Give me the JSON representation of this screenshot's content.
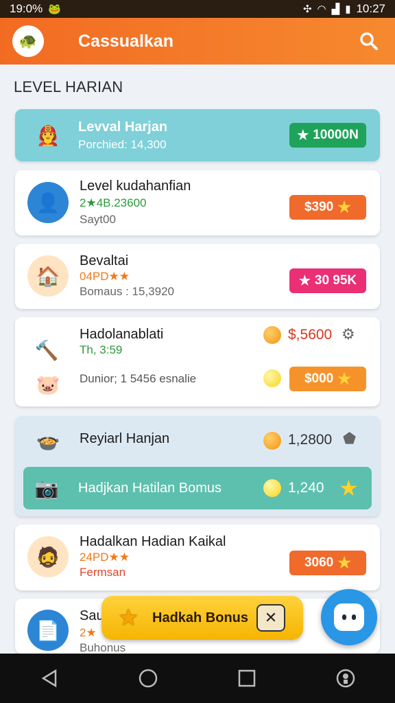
{
  "status_bar": {
    "left_text": "19:0%",
    "time": "10:27"
  },
  "app_bar": {
    "title": "Cassualkan"
  },
  "section": {
    "heading": "LEVEL HARIAN"
  },
  "cards": [
    {
      "title": "Levval Harjan",
      "sub": "Porchied: 14,300",
      "reward": "10000N",
      "reward_icon": "star"
    },
    {
      "title": "Level kudahanfian",
      "sub": "2★4B.23600",
      "sub2": "Sayt00",
      "reward": "$390"
    },
    {
      "title": "Bevaltai",
      "sub": "04PD★★",
      "sub2": "Bomaus : 15,3920",
      "reward": "30 95K"
    },
    {
      "title": "Hadolanablati",
      "sub": "Th, 3:59",
      "sub2": "Dunior; 1 5456 esnalie",
      "amount1": "$,5600",
      "reward": "$000"
    },
    {
      "title": "Reyiarl Hanjan",
      "amount1": "1,2800",
      "inner_title": "Hadjkan Hatilan Bomus",
      "amount2": "1,240"
    },
    {
      "title": "Hadalkan Hadian Kaikal",
      "sub": "24PD★★",
      "sub2": "Fermsan",
      "reward": "3060"
    },
    {
      "title": "Sau",
      "sub": "2★",
      "sub2": "Buhonus"
    }
  ],
  "bonus_banner": {
    "label": "Hadkah Bonus"
  },
  "colors": {
    "accent": "#f26b22",
    "teal": "#7fd0d8",
    "green_pill": "#1fa35b",
    "orange_pill": "#f06a2c",
    "pink_pill": "#ea2f74"
  }
}
